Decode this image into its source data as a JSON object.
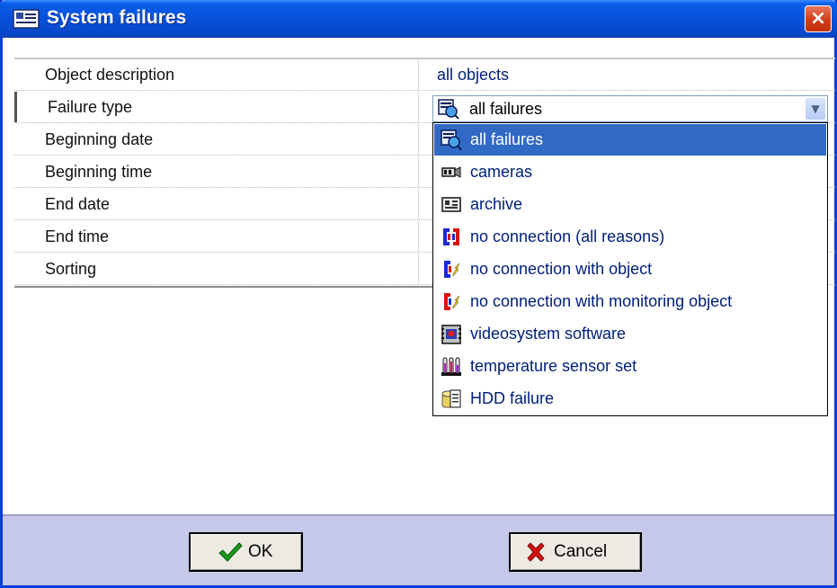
{
  "window": {
    "title": "System failures",
    "close_label": "×"
  },
  "properties": [
    {
      "name": "Object description",
      "value": "all objects"
    },
    {
      "name": "Failure type",
      "value": "all failures"
    },
    {
      "name": "Beginning date",
      "value": ""
    },
    {
      "name": "Beginning time",
      "value": ""
    },
    {
      "name": "End date",
      "value": ""
    },
    {
      "name": "End time",
      "value": ""
    },
    {
      "name": "Sorting",
      "value": ""
    }
  ],
  "failure_type_combo": {
    "selected": "all failures",
    "selected_icon": "all-failures-icon",
    "arrow_icon": "chevron-down-icon",
    "arrow_glyph": "▼"
  },
  "dropdown": {
    "selected_index": 0,
    "options": [
      {
        "label": "all failures",
        "icon": "all-failures-icon"
      },
      {
        "label": "cameras",
        "icon": "camera-icon"
      },
      {
        "label": "archive",
        "icon": "archive-icon"
      },
      {
        "label": "no connection (all reasons)",
        "icon": "no-connection-icon"
      },
      {
        "label": "no connection with object",
        "icon": "no-connection-object-icon"
      },
      {
        "label": "no connection with monitoring object",
        "icon": "no-connection-monitoring-icon"
      },
      {
        "label": "videosystem software",
        "icon": "videosystem-software-icon"
      },
      {
        "label": "temperature sensor set",
        "icon": "temperature-sensor-icon"
      },
      {
        "label": "HDD failure",
        "icon": "hdd-failure-icon"
      }
    ]
  },
  "buttons": {
    "ok_label": "OK",
    "cancel_label": "Cancel"
  },
  "colors": {
    "titlebar": "#0754df",
    "selection": "#316ac5",
    "value_text": "#00207a",
    "footer": "#c5c8e8"
  }
}
